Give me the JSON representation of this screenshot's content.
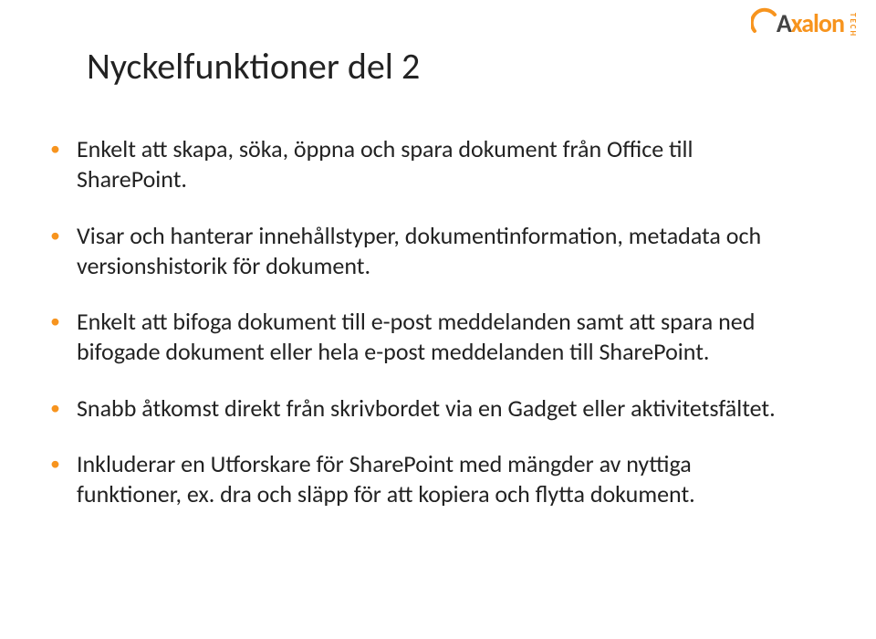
{
  "logo": {
    "brand_part1": "A",
    "brand_part2": "xalon",
    "tag": "TECH"
  },
  "title": "Nyckelfunktioner del 2",
  "bullets": [
    "Enkelt att skapa, söka, öppna och spara dokument från Office till SharePoint.",
    "Visar och hanterar innehållstyper, dokumentinformation, metadata och versionshistorik för dokument.",
    "Enkelt att bifoga dokument till e-post meddelanden samt att spara ned bifogade dokument eller hela e-post meddelanden till SharePoint.",
    "Snabb åtkomst direkt från skrivbordet via en Gadget eller aktivitetsfältet.",
    "Inkluderar en Utforskare för SharePoint med mängder av nyttiga funktioner, ex. dra och släpp för att kopiera och flytta dokument."
  ],
  "colors": {
    "accent": "#F7941E",
    "text": "#222222"
  }
}
